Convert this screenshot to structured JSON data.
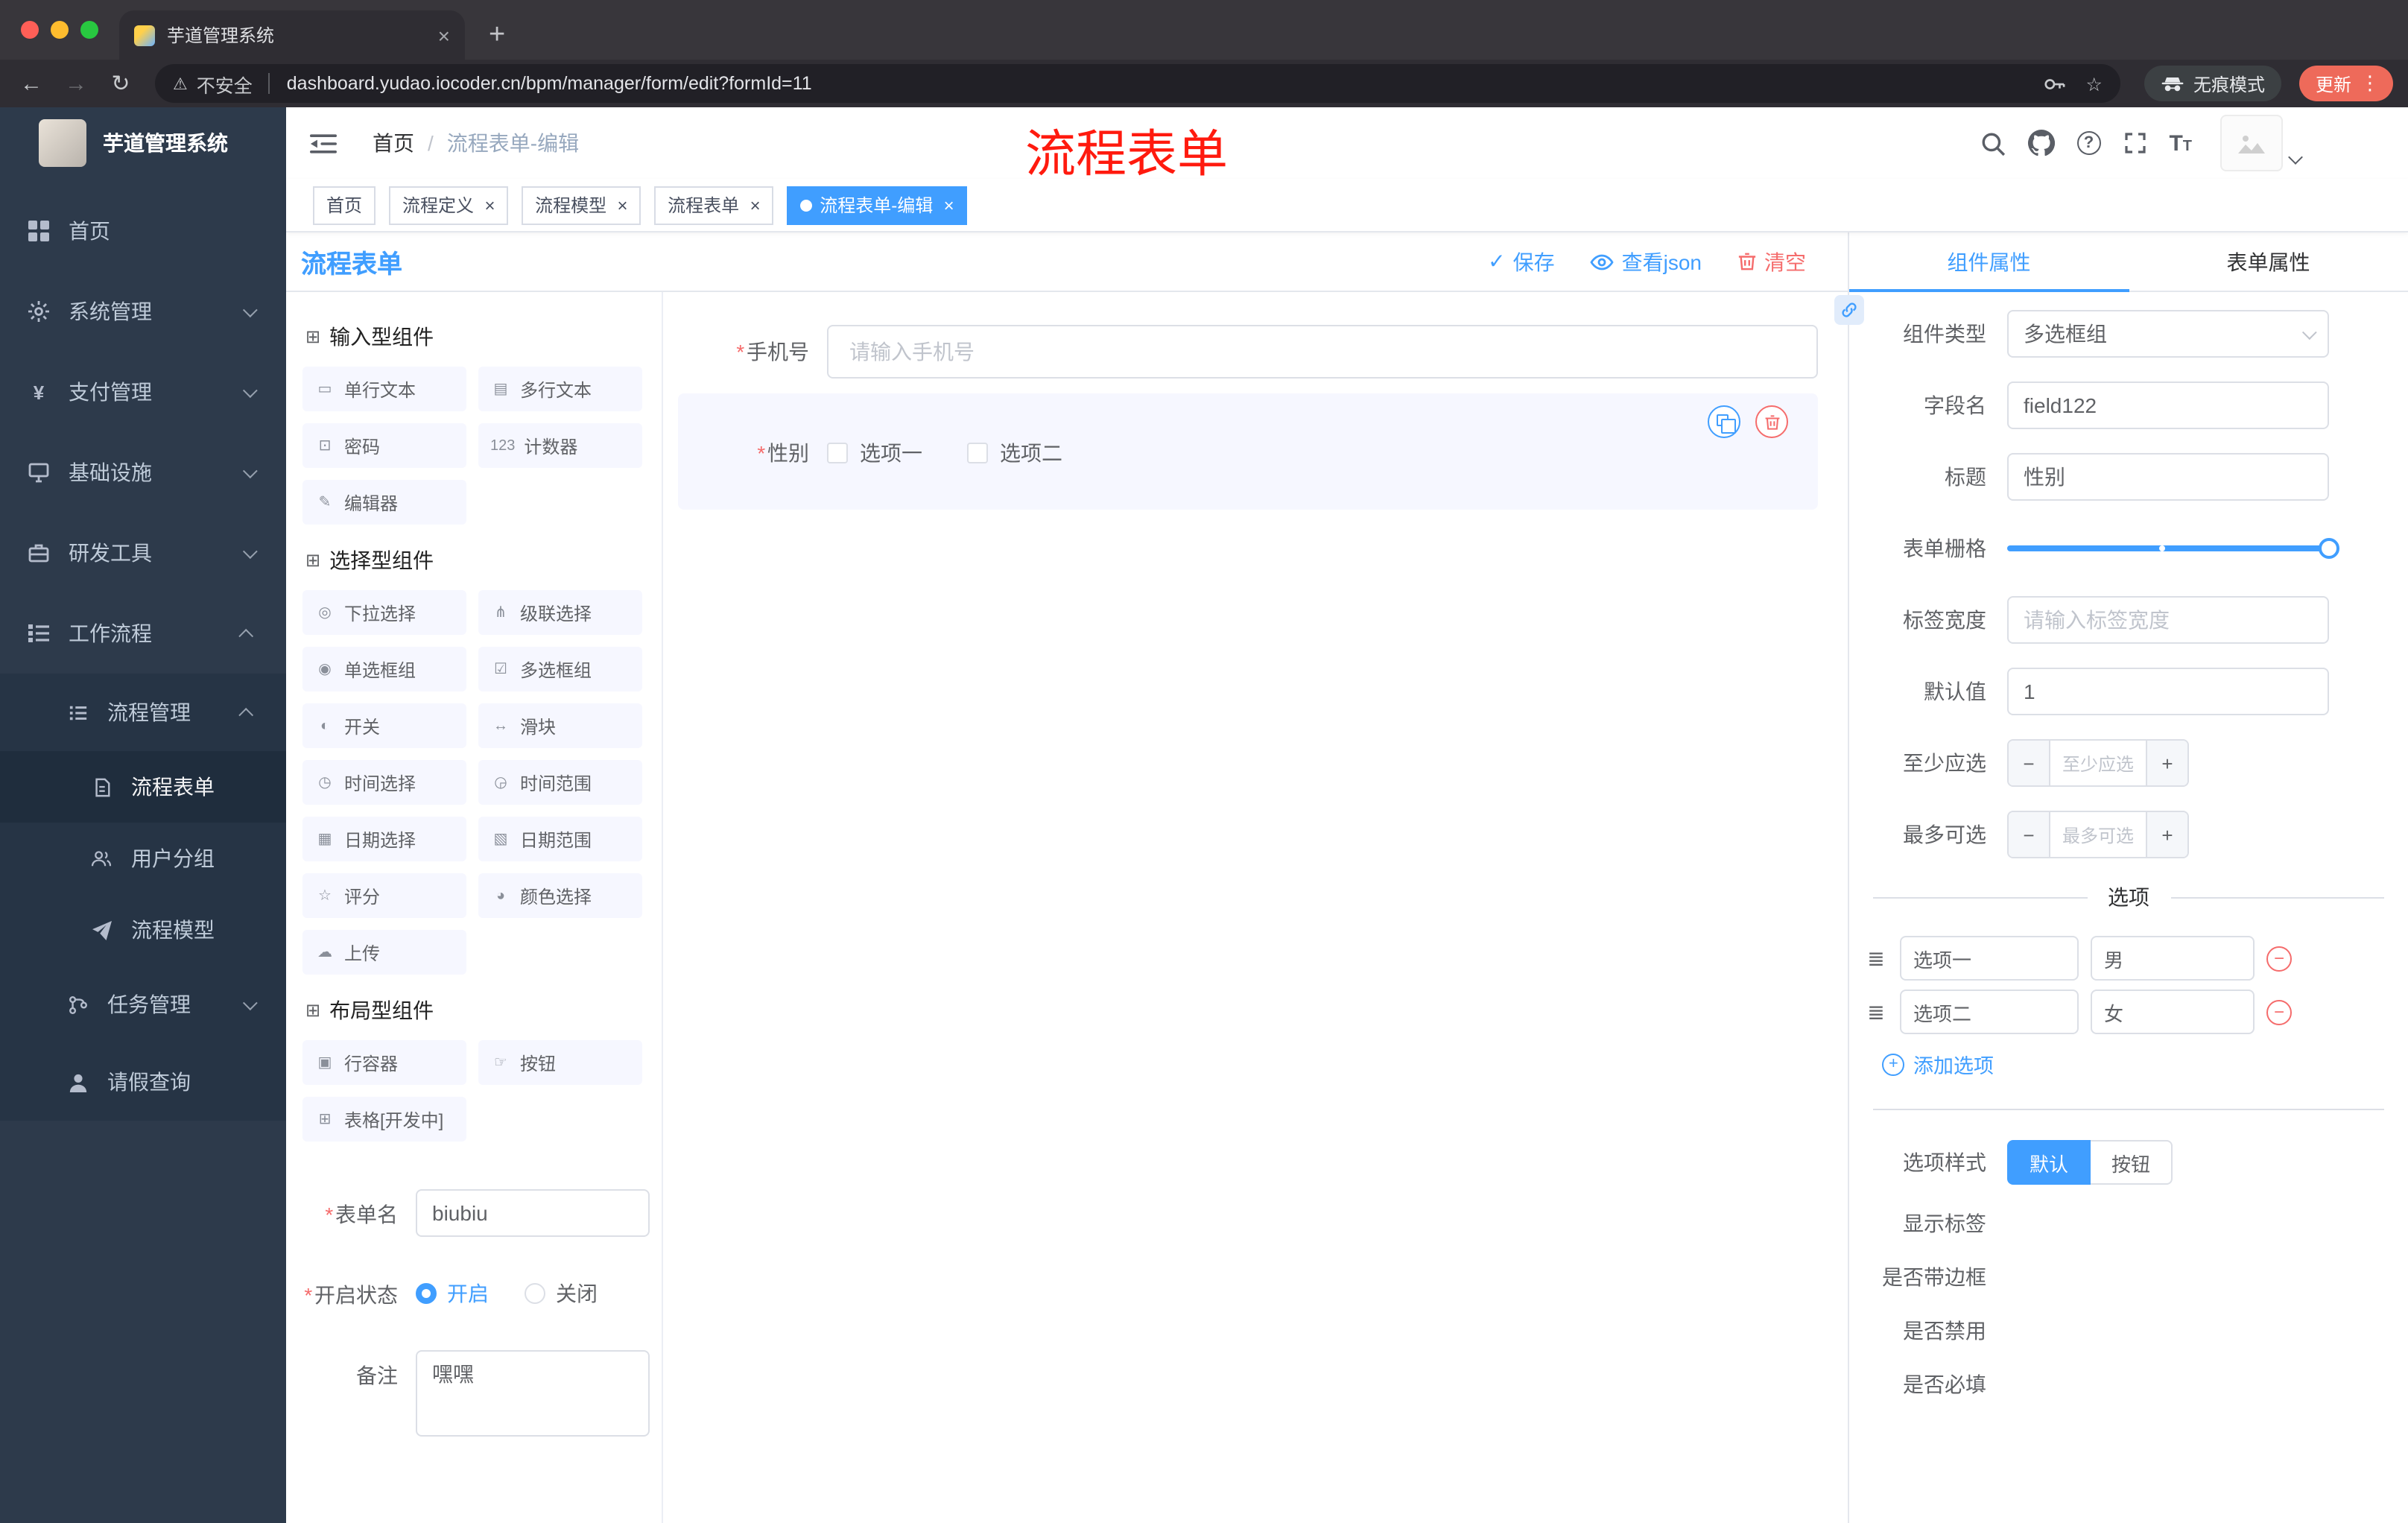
{
  "colors": {
    "accent": "#409eff",
    "danger": "#f56c6c",
    "sidebar_bg": "#2d3a4b",
    "annotation_color": "#ff1a0e"
  },
  "browser": {
    "tab_title": "芋道管理系统",
    "security_label": "不安全",
    "url": "dashboard.yudao.iocoder.cn/bpm/manager/form/edit?formId=11",
    "incognito_label": "无痕模式",
    "update_label": "更新"
  },
  "annotation": "流程表单",
  "sidebar": {
    "logo_title": "芋道管理系统",
    "menu": [
      {
        "label": "首页"
      },
      {
        "label": "系统管理"
      },
      {
        "label": "支付管理"
      },
      {
        "label": "基础设施"
      },
      {
        "label": "研发工具"
      },
      {
        "label": "工作流程"
      }
    ],
    "submenu": [
      {
        "label": "流程管理"
      },
      {
        "label": "流程表单"
      },
      {
        "label": "用户分组"
      },
      {
        "label": "流程模型"
      },
      {
        "label": "任务管理"
      },
      {
        "label": "请假查询"
      }
    ]
  },
  "header": {
    "breadcrumb_root": "首页",
    "breadcrumb_sep": "/",
    "breadcrumb_current": "流程表单-编辑"
  },
  "tags": [
    {
      "label": "首页",
      "active": "false",
      "closable": "false"
    },
    {
      "label": "流程定义",
      "active": "false",
      "closable": "true"
    },
    {
      "label": "流程模型",
      "active": "false",
      "closable": "true"
    },
    {
      "label": "流程表单",
      "active": "false",
      "closable": "true"
    },
    {
      "label": "流程表单-编辑",
      "active": "true",
      "closable": "true"
    }
  ],
  "designer": {
    "title": "流程表单",
    "actions": {
      "save": "保存",
      "view_json": "查看json",
      "clear": "清空"
    },
    "groups": [
      {
        "title": "输入型组件",
        "icon": "⊞",
        "items": [
          {
            "label": "单行文本",
            "glyph": "▭"
          },
          {
            "label": "多行文本",
            "glyph": "▤"
          },
          {
            "label": "密码",
            "glyph": "⊡"
          },
          {
            "label": "计数器",
            "glyph": "123"
          },
          {
            "label": "编辑器",
            "glyph": "✎"
          }
        ]
      },
      {
        "title": "选择型组件",
        "icon": "⊞",
        "items": [
          {
            "label": "下拉选择",
            "glyph": "◎"
          },
          {
            "label": "级联选择",
            "glyph": "⋔"
          },
          {
            "label": "单选框组",
            "glyph": "◉"
          },
          {
            "label": "多选框组",
            "glyph": "☑"
          },
          {
            "label": "开关",
            "glyph": "◐"
          },
          {
            "label": "滑块",
            "glyph": "↔"
          },
          {
            "label": "时间选择",
            "glyph": "◷"
          },
          {
            "label": "时间范围",
            "glyph": "◶"
          },
          {
            "label": "日期选择",
            "glyph": "▦"
          },
          {
            "label": "日期范围",
            "glyph": "▧"
          },
          {
            "label": "评分",
            "glyph": "☆"
          },
          {
            "label": "颜色选择",
            "glyph": "◕"
          },
          {
            "label": "上传",
            "glyph": "☁"
          }
        ]
      },
      {
        "title": "布局型组件",
        "icon": "⊞",
        "items": [
          {
            "label": "行容器",
            "glyph": "▣"
          },
          {
            "label": "按钮",
            "glyph": "☞"
          },
          {
            "label": "表格[开发中]",
            "glyph": "⊞"
          }
        ]
      }
    ],
    "meta": {
      "name_label": "表单名",
      "name_value": "biubiu",
      "status_label": "开启状态",
      "status_on": "开启",
      "status_off": "关闭",
      "remark_label": "备注",
      "remark_value": "嘿嘿"
    }
  },
  "canvas": {
    "phone_label": "手机号",
    "phone_placeholder": "请输入手机号",
    "gender_label": "性别",
    "gender_options": [
      "选项一",
      "选项二"
    ]
  },
  "props": {
    "tab_component": "组件属性",
    "tab_form": "表单属性",
    "type_label": "组件类型",
    "type_value": "多选框组",
    "field_label": "字段名",
    "field_value": "field122",
    "title_label": "标题",
    "title_value": "性别",
    "grid_label": "表单栅格",
    "width_label": "标签宽度",
    "width_placeholder": "请输入标签宽度",
    "default_label": "默认值",
    "default_value": "1",
    "min_label": "至少应选",
    "min_placeholder": "至少应选",
    "max_label": "最多可选",
    "max_placeholder": "最多可选",
    "options_title": "选项",
    "options": [
      {
        "name": "选项一",
        "value": "男"
      },
      {
        "name": "选项二",
        "value": "女"
      }
    ],
    "add_option": "添加选项",
    "style_label": "选项样式",
    "style_default": "默认",
    "style_button": "按钮",
    "switches": [
      {
        "label": "显示标签",
        "state": "on"
      },
      {
        "label": "是否带边框",
        "state": "off"
      },
      {
        "label": "是否禁用",
        "state": "off"
      },
      {
        "label": "是否必填",
        "state": "on"
      }
    ]
  }
}
